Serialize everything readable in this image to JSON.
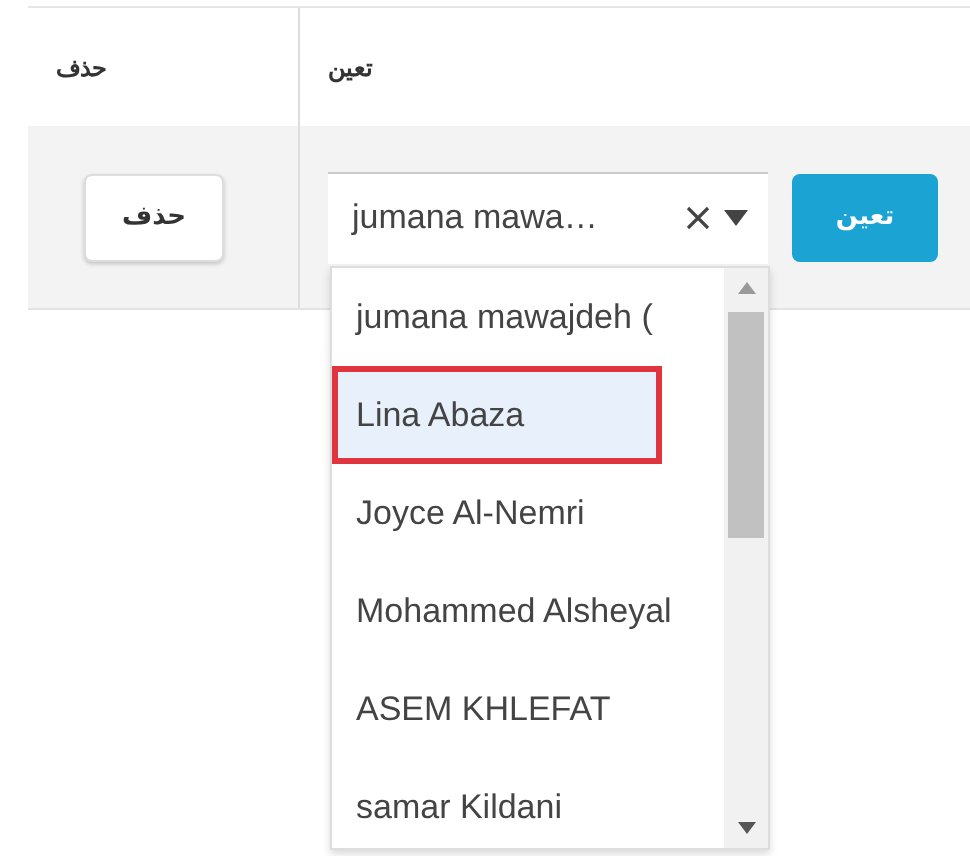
{
  "table": {
    "columns": [
      {
        "label": "تعين"
      },
      {
        "label": "حذف"
      }
    ],
    "row": {
      "delete_button": "حذف",
      "assign_select": {
        "value": "jumana mawa…",
        "expanded": true
      },
      "assign_button": "تعين"
    }
  },
  "dropdown": {
    "options": [
      {
        "label": "jumana mawajdeh (",
        "selected": false,
        "annotated": false
      },
      {
        "label": "Lina Abaza",
        "selected": true,
        "annotated": true
      },
      {
        "label": "Joyce Al-Nemri",
        "selected": false,
        "annotated": false
      },
      {
        "label": "Mohammed Alsheyal",
        "selected": false,
        "annotated": false
      },
      {
        "label": "ASEM KHLEFAT",
        "selected": false,
        "annotated": false
      },
      {
        "label": "samar Kildani",
        "selected": false,
        "annotated": false
      }
    ]
  }
}
